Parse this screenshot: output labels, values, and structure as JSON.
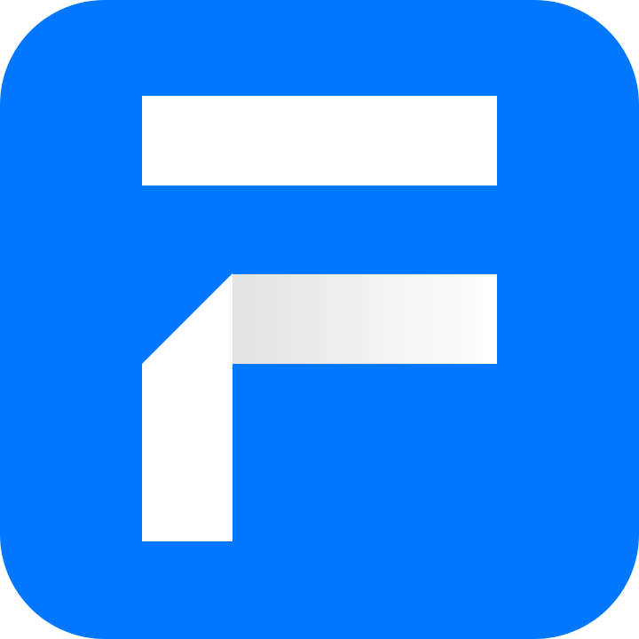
{
  "icon": {
    "name": "app-logo-f",
    "background_color": "#0077FF",
    "glyph_color": "#FFFFFF",
    "glyph_gradient_start": "#E3E3E3",
    "glyph_gradient_end": "#FFFFFF"
  }
}
